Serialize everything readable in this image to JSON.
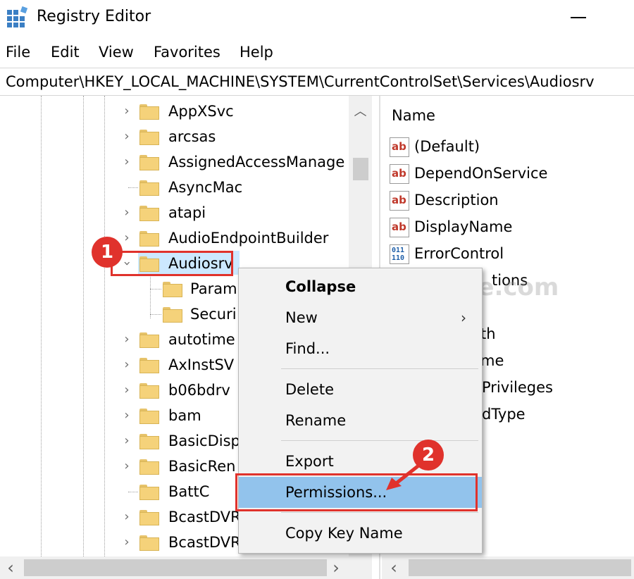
{
  "window": {
    "title": "Registry Editor"
  },
  "menubar": {
    "items": [
      "File",
      "Edit",
      "View",
      "Favorites",
      "Help"
    ]
  },
  "address": {
    "path": "Computer\\HKEY_LOCAL_MACHINE\\SYSTEM\\CurrentControlSet\\Services\\Audiosrv"
  },
  "tree": {
    "rows": [
      {
        "name": "AppXSvc"
      },
      {
        "name": "arcsas"
      },
      {
        "name": "AssignedAccessManage"
      },
      {
        "name": "AsyncMac"
      },
      {
        "name": "atapi"
      },
      {
        "name": "AudioEndpointBuilder"
      },
      {
        "name": "Audiosrv"
      },
      {
        "name": "Param"
      },
      {
        "name": "Securi"
      },
      {
        "name": "autotime"
      },
      {
        "name": "AxInstSV"
      },
      {
        "name": "b06bdrv"
      },
      {
        "name": "bam"
      },
      {
        "name": "BasicDisp"
      },
      {
        "name": "BasicRen"
      },
      {
        "name": "BattC"
      },
      {
        "name": "BcastDVR"
      },
      {
        "name": "BcastDVR"
      }
    ]
  },
  "values": {
    "column_header": "Name",
    "rows": [
      {
        "name": "(Default)",
        "icon": "string-value-icon"
      },
      {
        "name": "DependOnService",
        "icon": "string-value-icon"
      },
      {
        "name": "Description",
        "icon": "string-value-icon"
      },
      {
        "name": "DisplayName",
        "icon": "string-value-icon"
      },
      {
        "name": "ErrorControl",
        "icon": "dword-value-icon"
      },
      {
        "name": "tions"
      },
      {
        "name": "th"
      },
      {
        "name": "me"
      },
      {
        "name": "Privileges"
      },
      {
        "name": "dType"
      }
    ]
  },
  "context_menu": {
    "items": [
      {
        "label": "Collapse",
        "bold": true
      },
      {
        "label": "New",
        "submenu": "›"
      },
      {
        "label": "Find..."
      },
      {
        "label": "Delete"
      },
      {
        "label": "Rename"
      },
      {
        "label": "Export"
      },
      {
        "label": "Permissions...",
        "highlighted": true
      },
      {
        "label": "Copy Key Name"
      }
    ]
  },
  "annotations": {
    "badge1": "1",
    "badge2": "2",
    "color": "#e0322c"
  },
  "watermark": "TheGeekPage.com",
  "icons": {
    "ab_text": "ab",
    "bin_text": "011\n110"
  }
}
